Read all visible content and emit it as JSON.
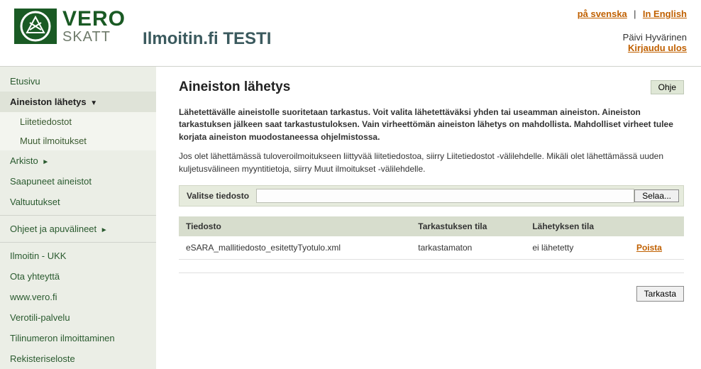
{
  "header": {
    "logo_top": "VERO",
    "logo_bottom": "SKATT",
    "site_title": "Ilmoitin.fi TESTI",
    "lang": {
      "sv": "på svenska",
      "en": "In English"
    },
    "user_name": "Päivi Hyvärinen",
    "logout": "Kirjaudu ulos"
  },
  "sidebar": {
    "items": [
      {
        "label": "Etusivu"
      },
      {
        "label": "Aineiston lähetys",
        "arrow": "▼",
        "active": true
      },
      {
        "label": "Liitetiedostot",
        "sub": true
      },
      {
        "label": "Muut ilmoitukset",
        "sub": true
      },
      {
        "label": "Arkisto",
        "arrow": "►"
      },
      {
        "label": "Saapuneet aineistot"
      },
      {
        "label": "Valtuutukset"
      },
      {
        "label": "Ohjeet ja apuvälineet",
        "arrow": "►"
      },
      {
        "label": "Ilmoitin - UKK"
      },
      {
        "label": "Ota yhteyttä"
      },
      {
        "label": "www.vero.fi"
      },
      {
        "label": "Verotili-palvelu"
      },
      {
        "label": "Tilinumeron ilmoittaminen"
      },
      {
        "label": "Rekisteriseloste"
      }
    ]
  },
  "main": {
    "title": "Aineiston lähetys",
    "help_btn": "Ohje",
    "intro_bold": "Lähetettävälle aineistolle suoritetaan tarkastus. Voit valita lähetettäväksi yhden tai useamman aineiston. Aineiston tarkastuksen jälkeen saat tarkastustuloksen. Vain virheettömän aineiston lähetys on mahdollista. Mahdolliset virheet tulee korjata aineiston muodostaneessa ohjelmistossa.",
    "intro_plain": "Jos olet lähettämässä tuloveroilmoitukseen liittyvää liitetiedostoa, siirry Liitetiedostot -välilehdelle. Mikäli olet lähettämässä uuden kuljetusvälineen myyntitietoja, siirry Muut ilmoitukset -välilehdelle.",
    "file_label": "Valitse tiedosto",
    "browse": "Selaa...",
    "file_value": "",
    "table": {
      "headers": [
        "Tiedosto",
        "Tarkastuksen tila",
        "Lähetyksen tila",
        ""
      ],
      "rows": [
        {
          "file": "eSARA_mallitiedosto_esitettyTyotulo.xml",
          "check": "tarkastamaton",
          "send": "ei lähetetty",
          "action": "Poista"
        }
      ]
    },
    "check_btn": "Tarkasta"
  }
}
